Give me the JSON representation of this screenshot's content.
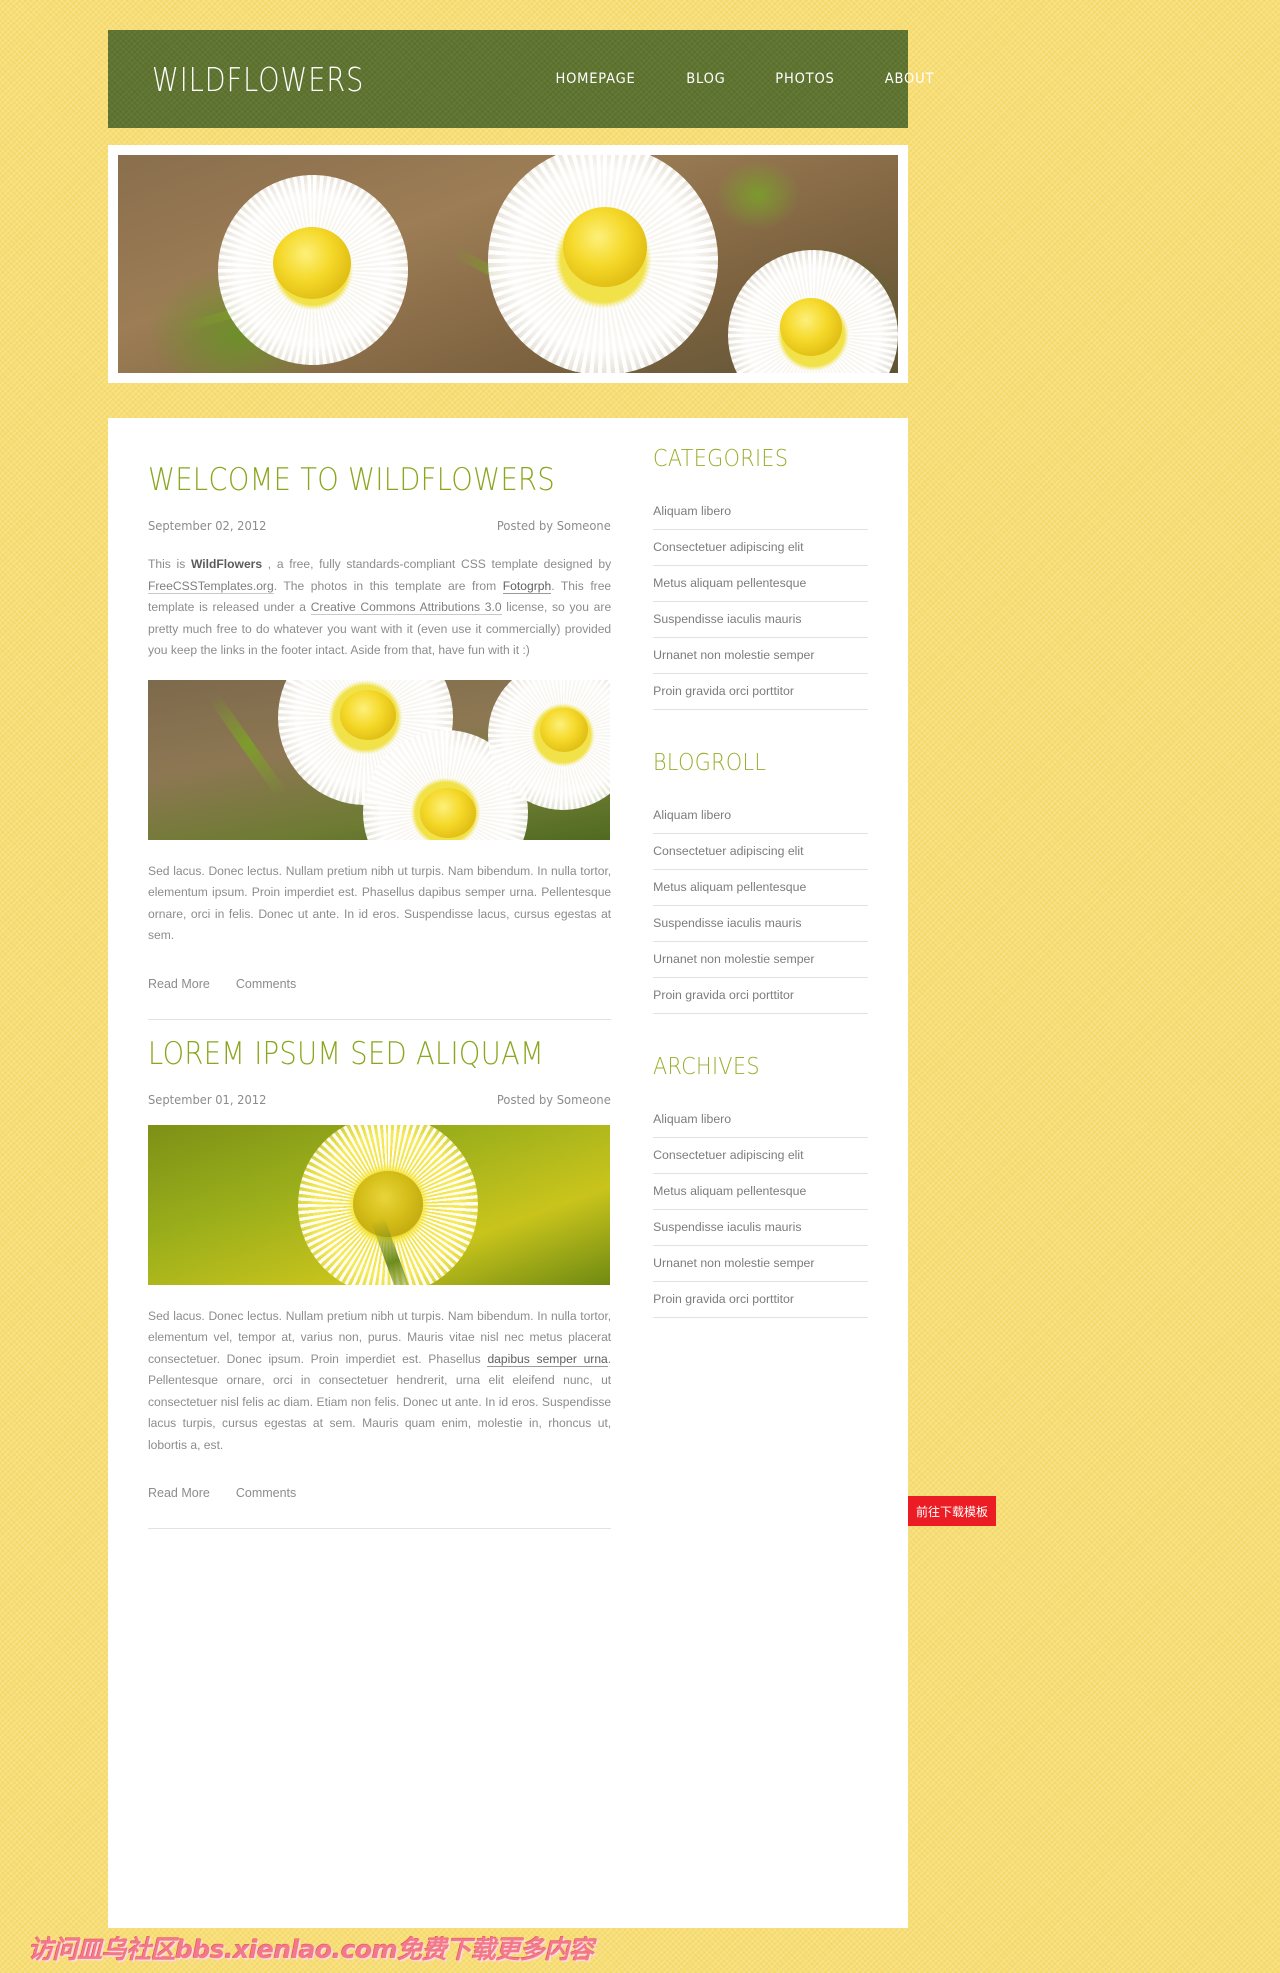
{
  "site": {
    "logo": "WILDFLOWERS",
    "accent_green": "#8aa61e",
    "header_green": "#5f7430",
    "page_bg": "#f7dd73"
  },
  "nav": {
    "items": [
      {
        "label": "HOMEPAGE"
      },
      {
        "label": "BLOG"
      },
      {
        "label": "PHOTOS"
      },
      {
        "label": "ABOUT"
      }
    ]
  },
  "posts": [
    {
      "title": "WELCOME TO WILDFLOWERS",
      "date": "September 02, 2012",
      "author": "Posted by Someone",
      "intro_1": "This is ",
      "intro_brand": "WildFlowers",
      "intro_2": " , a free, fully standards-compliant CSS template designed by ",
      "link_site": "FreeCSSTemplates.org",
      "intro_3": ". The photos in this template are from ",
      "link_photos": "Fotogrph",
      "intro_4": ". This free template is released under a ",
      "link_license": "Creative Commons Attributions 3.0",
      "intro_5": " license, so you are pretty much free to do whatever you want with it (even use it commercially) provided you keep the links in the footer intact. Aside from that, have fun with it :)",
      "body": "Sed lacus. Donec lectus. Nullam pretium nibh ut turpis. Nam bibendum. In nulla tortor, elementum ipsum. Proin imperdiet est. Phasellus dapibus semper urna. Pellentesque ornare, orci in felis. Donec ut ante. In id eros. Suspendisse lacus, cursus egestas at sem.",
      "read_more": "Read More",
      "comments": "Comments"
    },
    {
      "title": "LOREM IPSUM SED ALIQUAM",
      "date": "September 01, 2012",
      "author": "Posted by Someone",
      "body_1": "Sed lacus. Donec lectus. Nullam pretium nibh ut turpis. Nam bibendum. In nulla tortor, elementum vel, tempor at, varius non, purus. Mauris vitae nisl nec metus placerat consectetuer. Donec ipsum. Proin imperdiet est. Phasellus ",
      "body_emphasis": "dapibus semper urna",
      "body_2": ". Pellentesque ornare, orci in consectetuer hendrerit, urna elit eleifend nunc, ut consectetuer nisl felis ac diam. Etiam non felis. Donec ut ante. In id eros. Suspendisse lacus turpis, cursus egestas at sem. Mauris quam enim, molestie in, rhoncus ut, lobortis a, est.",
      "read_more": "Read More",
      "comments": "Comments"
    }
  ],
  "sidebar": {
    "sections": [
      {
        "title": "CATEGORIES",
        "items": [
          "Aliquam libero",
          "Consectetuer adipiscing elit",
          "Metus aliquam pellentesque",
          "Suspendisse iaculis mauris",
          "Urnanet non molestie semper",
          "Proin gravida orci porttitor"
        ]
      },
      {
        "title": "BLOGROLL",
        "items": [
          "Aliquam libero",
          "Consectetuer adipiscing elit",
          "Metus aliquam pellentesque",
          "Suspendisse iaculis mauris",
          "Urnanet non molestie semper",
          "Proin gravida orci porttitor"
        ]
      },
      {
        "title": "ARCHIVES",
        "items": [
          "Aliquam libero",
          "Consectetuer adipiscing elit",
          "Metus aliquam pellentesque",
          "Suspendisse iaculis mauris",
          "Urnanet non molestie semper",
          "Proin gravida orci porttitor"
        ]
      }
    ]
  },
  "overlay": {
    "watermark": "访问皿乌社区bbs.xienlao.com免费下载更多内容",
    "download_button": "前往下载模板"
  }
}
